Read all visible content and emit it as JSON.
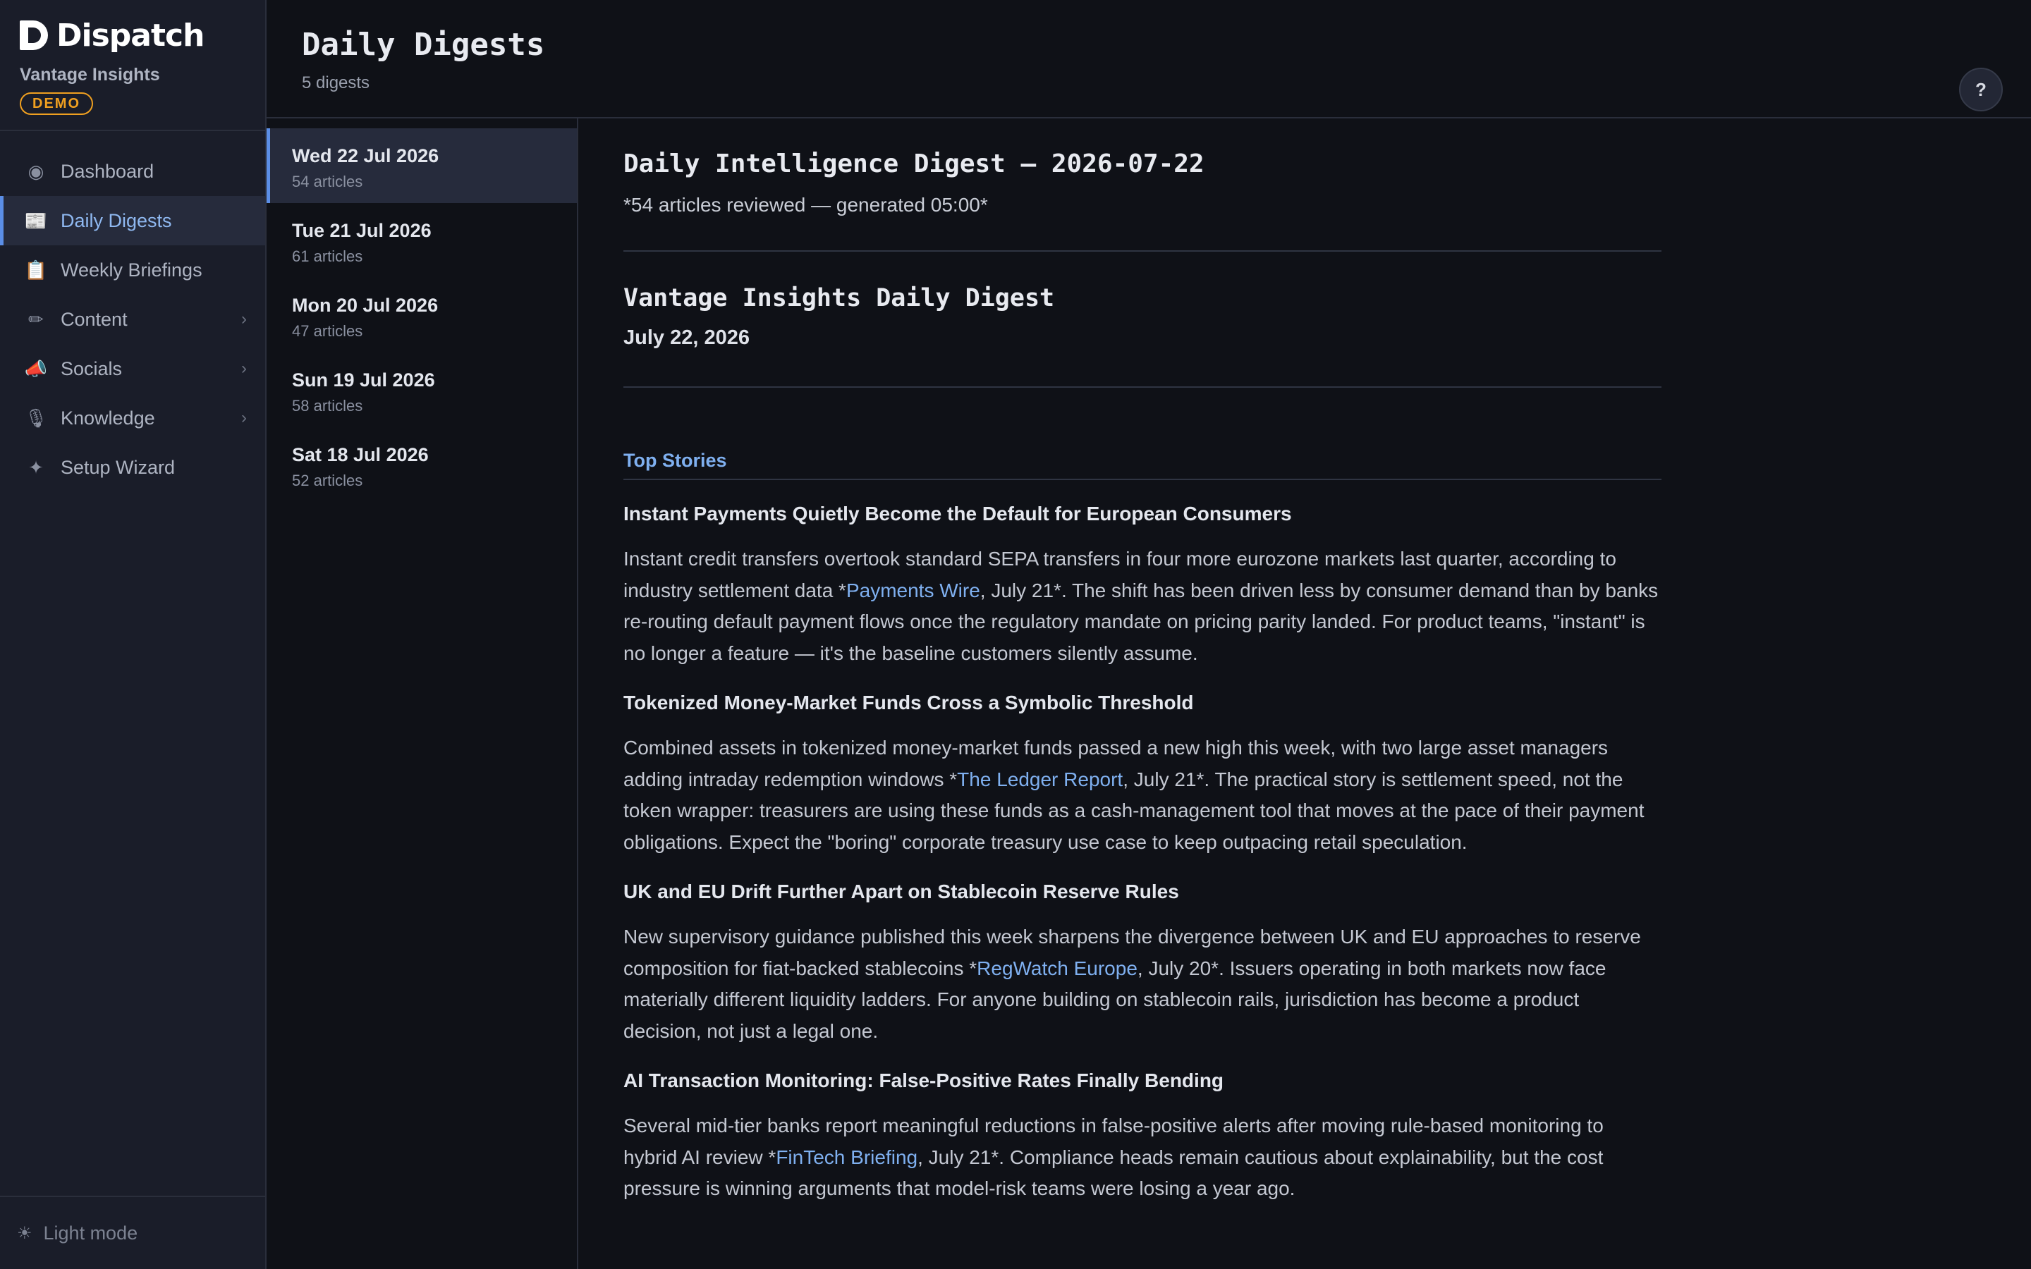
{
  "brand": {
    "name": "Dispatch",
    "org": "Vantage Insights",
    "badge": "DEMO"
  },
  "nav": [
    {
      "label": "Dashboard",
      "icon": "◉",
      "icon_name": "dashboard-icon",
      "chevron": ""
    },
    {
      "label": "Daily Digests",
      "icon": "📰",
      "icon_name": "newspaper-icon",
      "chevron": ""
    },
    {
      "label": "Weekly Briefings",
      "icon": "📋",
      "icon_name": "clipboard-icon",
      "chevron": ""
    },
    {
      "label": "Content",
      "icon": "✏",
      "icon_name": "pencil-icon",
      "chevron": "›"
    },
    {
      "label": "Socials",
      "icon": "📣",
      "icon_name": "megaphone-icon",
      "chevron": "›"
    },
    {
      "label": "Knowledge",
      "icon": "🎙",
      "icon_name": "microphone-icon",
      "chevron": "›"
    },
    {
      "label": "Setup Wizard",
      "icon": "✦",
      "icon_name": "sparkle-icon",
      "chevron": ""
    }
  ],
  "footer": {
    "label": "Light mode",
    "icon": "☀"
  },
  "header": {
    "title": "Daily Digests",
    "subtitle": "5 digests",
    "help": "?"
  },
  "digests": [
    {
      "date": "Wed 22 Jul 2026",
      "count": "54 articles"
    },
    {
      "date": "Tue 21 Jul 2026",
      "count": "61 articles"
    },
    {
      "date": "Mon 20 Jul 2026",
      "count": "47 articles"
    },
    {
      "date": "Sun 19 Jul 2026",
      "count": "58 articles"
    },
    {
      "date": "Sat 18 Jul 2026",
      "count": "52 articles"
    }
  ],
  "article": {
    "title": "Daily Intelligence Digest — 2026-07-22",
    "meta": "*54 articles reviewed — generated 05:00*",
    "section_title": "Vantage Insights Daily Digest",
    "section_date": "July 22, 2026",
    "top_stories": "Top Stories",
    "stories": [
      {
        "title": "Instant Payments Quietly Become the Default for European Consumers",
        "pre": "Instant credit transfers overtook standard SEPA transfers in four more eurozone markets last quarter, according to industry settlement data *",
        "source": "Payments Wire",
        "post": ", July 21*. The shift has been driven less by consumer demand than by banks re-routing default payment flows once the regulatory mandate on pricing parity landed. For product teams, \"instant\" is no longer a feature — it's the baseline customers silently assume."
      },
      {
        "title": "Tokenized Money-Market Funds Cross a Symbolic Threshold",
        "pre": "Combined assets in tokenized money-market funds passed a new high this week, with two large asset managers adding intraday redemption windows *",
        "source": "The Ledger Report",
        "post": ", July 21*. The practical story is settlement speed, not the token wrapper: treasurers are using these funds as a cash-management tool that moves at the pace of their payment obligations. Expect the \"boring\" corporate treasury use case to keep outpacing retail speculation."
      },
      {
        "title": "UK and EU Drift Further Apart on Stablecoin Reserve Rules",
        "pre": "New supervisory guidance published this week sharpens the divergence between UK and EU approaches to reserve composition for fiat-backed stablecoins *",
        "source": "RegWatch Europe",
        "post": ", July 20*. Issuers operating in both markets now face materially different liquidity ladders. For anyone building on stablecoin rails, jurisdiction has become a product decision, not just a legal one."
      },
      {
        "title": "AI Transaction Monitoring: False-Positive Rates Finally Bending",
        "pre": "Several mid-tier banks report meaningful reductions in false-positive alerts after moving rule-based monitoring to hybrid AI review *",
        "source": "FinTech Briefing",
        "post": ", July 21*. Compliance heads remain cautious about explainability, but the cost pressure is winning arguments that model-risk teams were losing a year ago."
      }
    ]
  }
}
